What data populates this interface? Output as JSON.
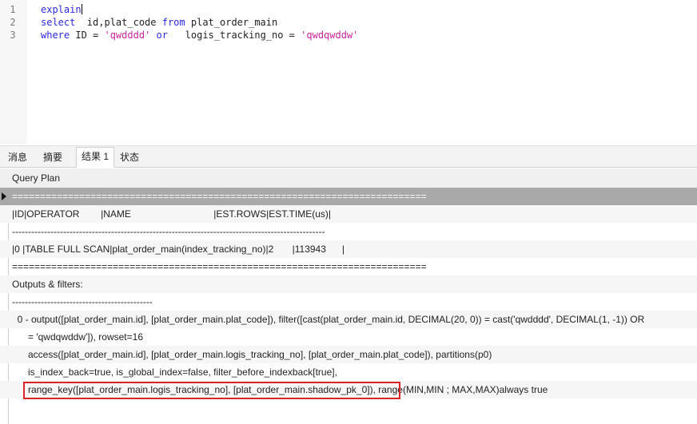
{
  "editor": {
    "lines": [
      {
        "num": "1",
        "tokens": [
          {
            "type": "kw",
            "text": "explain"
          }
        ]
      },
      {
        "num": "2",
        "tokens": [
          {
            "type": "kw",
            "text": "select"
          },
          {
            "type": "txt",
            "text": "  id,plat_code "
          },
          {
            "type": "kw",
            "text": "from"
          },
          {
            "type": "txt",
            "text": " plat_order_main"
          }
        ]
      },
      {
        "num": "3",
        "tokens": [
          {
            "type": "kw",
            "text": "where"
          },
          {
            "type": "txt",
            "text": " ID = "
          },
          {
            "type": "str",
            "text": "'qwdddd'"
          },
          {
            "type": "txt",
            "text": " "
          },
          {
            "type": "kw",
            "text": "or"
          },
          {
            "type": "txt",
            "text": "   logis_tracking_no = "
          },
          {
            "type": "str",
            "text": "'qwdqwddw'"
          }
        ]
      }
    ]
  },
  "tabs": [
    {
      "label": "消息",
      "active": false
    },
    {
      "label": "摘要",
      "active": false
    },
    {
      "label": "结果 1",
      "active": true
    },
    {
      "label": "状态",
      "active": false
    }
  ],
  "grid": {
    "column_header": "Query Plan",
    "rows": [
      "==========================================================================",
      "|ID|OPERATOR        |NAME                               |EST.ROWS|EST.TIME(us)|",
      "--------------------------------------------------------------------------------------------------",
      "|0 |TABLE FULL SCAN|plat_order_main(index_tracking_no)|2       |113943      |",
      "==========================================================================",
      "Outputs & filters:",
      "--------------------------------------------",
      "  0 - output([plat_order_main.id], [plat_order_main.plat_code]), filter([cast(plat_order_main.id, DECIMAL(20, 0)) = cast('qwdddd', DECIMAL(1, -1)) OR",
      "      = 'qwdqwddw']), rowset=16",
      "      access([plat_order_main.id], [plat_order_main.logis_tracking_no], [plat_order_main.plat_code]), partitions(p0)",
      "      is_index_back=true, is_global_index=false, filter_before_indexback[true],",
      "      range_key([plat_order_main.logis_tracking_no], [plat_order_main.shadow_pk_0]), range(MIN,MIN ; MAX,MAX)always true"
    ]
  },
  "colors": {
    "keyword": "#2a2ae0",
    "string": "#c8259a",
    "selected_row": "#a9a9a9",
    "annotation_box": "#d9252a"
  }
}
